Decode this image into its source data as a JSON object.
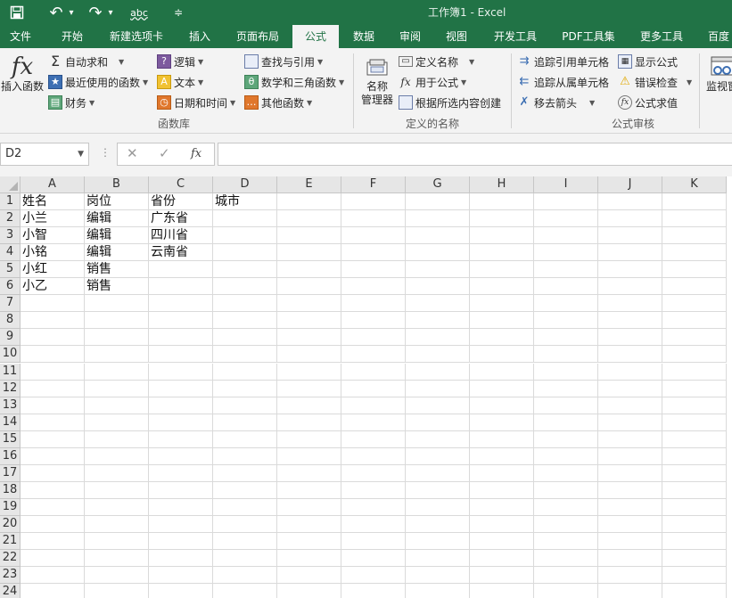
{
  "titlebar": {
    "title": "工作簿1 - Excel",
    "quick_access": [
      {
        "name": "save-icon",
        "glyph": "🖫"
      },
      {
        "name": "undo-icon",
        "glyph": "↶"
      },
      {
        "name": "undo-dropdown-icon",
        "glyph": "▾"
      },
      {
        "name": "redo-icon",
        "glyph": "↷"
      },
      {
        "name": "redo-dropdown-icon",
        "glyph": "▾"
      },
      {
        "name": "spelling-icon",
        "glyph": "abc"
      },
      {
        "name": "customize-quick-access-icon",
        "glyph": "≑"
      }
    ]
  },
  "tabs": [
    "文件",
    "开始",
    "新建选项卡",
    "插入",
    "页面布局",
    "公式",
    "数据",
    "审阅",
    "视图",
    "开发工具",
    "PDF工具集",
    "更多工具",
    "百度"
  ],
  "active_tab": "公式",
  "ribbon": {
    "function_library": {
      "label": "函数库",
      "insert_function": {
        "icon": "fx",
        "label": "插入函数"
      },
      "items": [
        {
          "label": "自动求和",
          "icon": "Σ"
        },
        {
          "label": "最近使用的函数",
          "icon": "★"
        },
        {
          "label": "财务",
          "icon": "▤"
        },
        {
          "label": "逻辑",
          "icon": "?"
        },
        {
          "label": "文本",
          "icon": "A"
        },
        {
          "label": "日期和时间",
          "icon": "◷"
        },
        {
          "label": "查找与引用",
          "icon": "🔍"
        },
        {
          "label": "数学和三角函数",
          "icon": "θ"
        },
        {
          "label": "其他函数",
          "icon": "…"
        }
      ]
    },
    "defined_names": {
      "label": "定义的名称",
      "name_manager": {
        "label_line1": "名称",
        "label_line2": "管理器"
      },
      "items": [
        {
          "label": "定义名称"
        },
        {
          "label": "用于公式"
        },
        {
          "label": "根据所选内容创建"
        }
      ]
    },
    "formula_auditing": {
      "label": "公式审核",
      "items": [
        {
          "label": "追踪引用单元格"
        },
        {
          "label": "追踪从属单元格"
        },
        {
          "label": "移去箭头"
        },
        {
          "label": "显示公式"
        },
        {
          "label": "错误检查"
        },
        {
          "label": "公式求值"
        }
      ],
      "watch_window": {
        "label": "监视窗"
      }
    }
  },
  "formula_bar": {
    "name_box": "D2",
    "cancel_glyph": "✕",
    "enter_glyph": "✓",
    "fx_glyph": "fx",
    "value": ""
  },
  "sheet": {
    "columns": [
      "A",
      "B",
      "C",
      "D",
      "E",
      "F",
      "G",
      "H",
      "I",
      "J",
      "K"
    ],
    "rows": [
      "1",
      "2",
      "3",
      "4",
      "5",
      "6",
      "7",
      "8",
      "9",
      "10",
      "11",
      "12",
      "13",
      "14",
      "15",
      "16",
      "17",
      "18",
      "19",
      "20",
      "21",
      "22",
      "23",
      "24"
    ],
    "data": [
      [
        "姓名",
        "岗位",
        "省份",
        "城市"
      ],
      [
        "小兰",
        "编辑",
        "广东省",
        ""
      ],
      [
        "小智",
        "编辑",
        "四川省",
        ""
      ],
      [
        "小铭",
        "编辑",
        "云南省",
        ""
      ],
      [
        "小红",
        "销售",
        "",
        ""
      ],
      [
        "小乙",
        "销售",
        "",
        ""
      ]
    ],
    "selected_cell": "D2"
  }
}
